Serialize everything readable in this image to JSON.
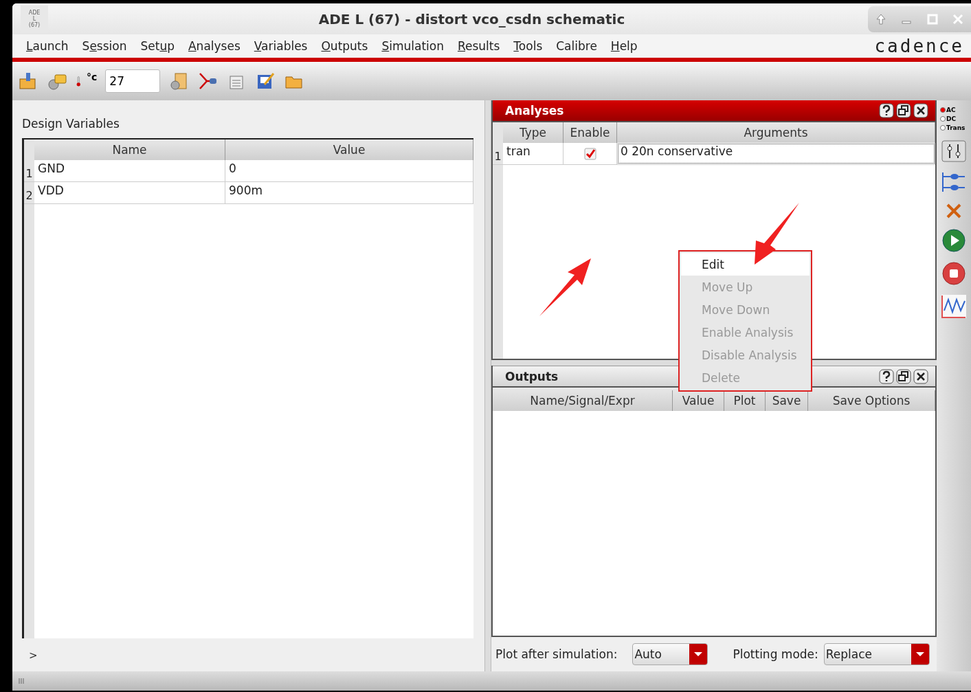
{
  "window": {
    "title": "ADE L (67) - distort vco_csdn schematic",
    "app_icon": [
      "ADE",
      "L",
      "(67)"
    ]
  },
  "menu": [
    {
      "label": "Launch"
    },
    {
      "label": "Session"
    },
    {
      "label": "Setup"
    },
    {
      "label": "Analyses"
    },
    {
      "label": "Variables"
    },
    {
      "label": "Outputs"
    },
    {
      "label": "Simulation"
    },
    {
      "label": "Results"
    },
    {
      "label": "Tools"
    },
    {
      "label": "Calibre"
    },
    {
      "label": "Help"
    }
  ],
  "logo": "cadence",
  "toolbar": {
    "temp_unit": "°c",
    "temperature": "27"
  },
  "design_variables": {
    "title": "Design Variables",
    "columns": [
      "Name",
      "Value"
    ],
    "rows": [
      {
        "index": "1",
        "name": "GND",
        "value": "0"
      },
      {
        "index": "2",
        "name": "VDD",
        "value": "900m"
      }
    ]
  },
  "prompt": ">",
  "analyses": {
    "title": "Analyses",
    "columns": [
      "Type",
      "Enable",
      "Arguments"
    ],
    "rows": [
      {
        "index": "1",
        "type": "tran",
        "enabled": true,
        "arguments": "0 20n conservative",
        "selected": true
      }
    ]
  },
  "context_menu": [
    {
      "label": "Edit",
      "disabled": false,
      "highlighted": true
    },
    {
      "label": "Move Up",
      "disabled": true,
      "highlighted": false
    },
    {
      "label": "Move Down",
      "disabled": true,
      "highlighted": false
    },
    {
      "label": "Enable Analysis",
      "disabled": true,
      "highlighted": false
    },
    {
      "label": "Disable Analysis",
      "disabled": true,
      "highlighted": false
    },
    {
      "label": "Delete",
      "disabled": true,
      "highlighted": false
    }
  ],
  "outputs": {
    "title": "Outputs",
    "columns": [
      "Name/Signal/Expr",
      "Value",
      "Plot",
      "Save",
      "Save Options"
    ]
  },
  "plot_after": {
    "label": "Plot after simulation:",
    "value": "Auto"
  },
  "plotting_mode": {
    "label": "Plotting mode:",
    "value": "Replace"
  },
  "side_toolbar": {
    "radios": [
      {
        "label": "AC",
        "selected": true
      },
      {
        "label": "DC",
        "selected": false
      },
      {
        "label": "Trans",
        "selected": false
      }
    ]
  }
}
